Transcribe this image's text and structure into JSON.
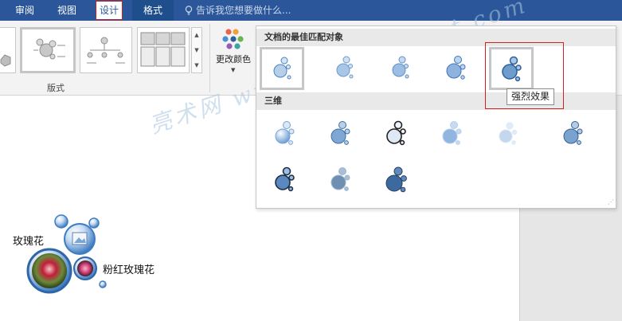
{
  "tabs": [
    {
      "label": "审阅"
    },
    {
      "label": "视图"
    },
    {
      "label": "设计"
    },
    {
      "label": "格式"
    }
  ],
  "tell_me": {
    "text": "告诉我您想要做什么..."
  },
  "ribbon": {
    "layout_group_label": "版式",
    "change_colors_label": "更改颜色"
  },
  "style_gallery": {
    "best_match_header": "文档的最佳匹配对象",
    "three_d_header": "三维",
    "tooltip": "强烈效果"
  },
  "watermark": {
    "text": "亮术网 www.liangshunet.com"
  },
  "smartart": {
    "label_left": "玫瑰花",
    "label_right": "粉红玫瑰花"
  },
  "colors": {
    "tab_bar": "#2b579a",
    "highlight": "#d52020",
    "bubble_fill": "#9ec3e8",
    "bubble_stroke": "#3f7cc2"
  }
}
